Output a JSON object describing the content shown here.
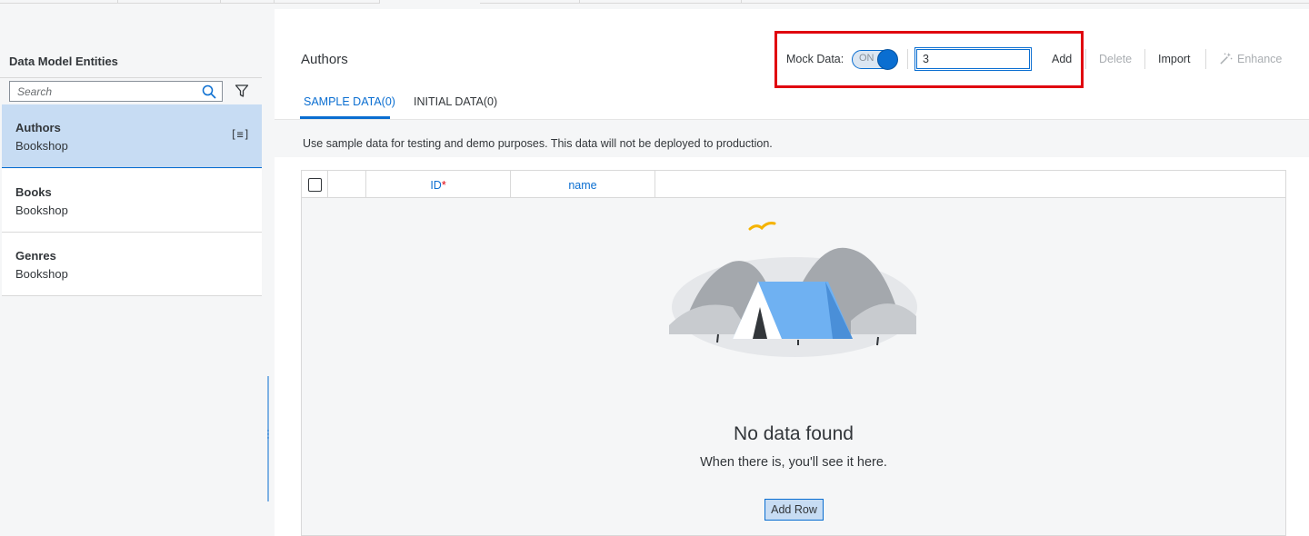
{
  "sidebar": {
    "title": "Data Model Entities",
    "search_placeholder": "Search",
    "items": [
      {
        "name": "Authors",
        "sub": "Bookshop",
        "selected": true,
        "icon": "[≡]"
      },
      {
        "name": "Books",
        "sub": "Bookshop",
        "selected": false
      },
      {
        "name": "Genres",
        "sub": "Bookshop",
        "selected": false
      }
    ]
  },
  "main": {
    "title": "Authors",
    "tabs": [
      {
        "label": "SAMPLE DATA(0)",
        "active": true
      },
      {
        "label": "INITIAL DATA(0)",
        "active": false
      }
    ],
    "info": "Use sample data for testing and demo purposes. This data will not be deployed to production."
  },
  "toolbar": {
    "mock_label": "Mock Data:",
    "toggle_text": "ON",
    "toggle_state": "on",
    "count_value": "3",
    "add_label": "Add",
    "delete_label": "Delete",
    "import_label": "Import",
    "enhance_label": "Enhance",
    "enhance_icon": "magic-wand-icon"
  },
  "table": {
    "columns": [
      {
        "label": "ID",
        "required_mark": "*"
      },
      {
        "label": "name"
      }
    ],
    "empty_title": "No data found",
    "empty_subtitle": "When there is, you'll see it here.",
    "add_row_label": "Add Row"
  },
  "colors": {
    "accent": "#0a6ed1",
    "highlight": "#e0000e",
    "selected_bg": "#c7dcf3"
  }
}
